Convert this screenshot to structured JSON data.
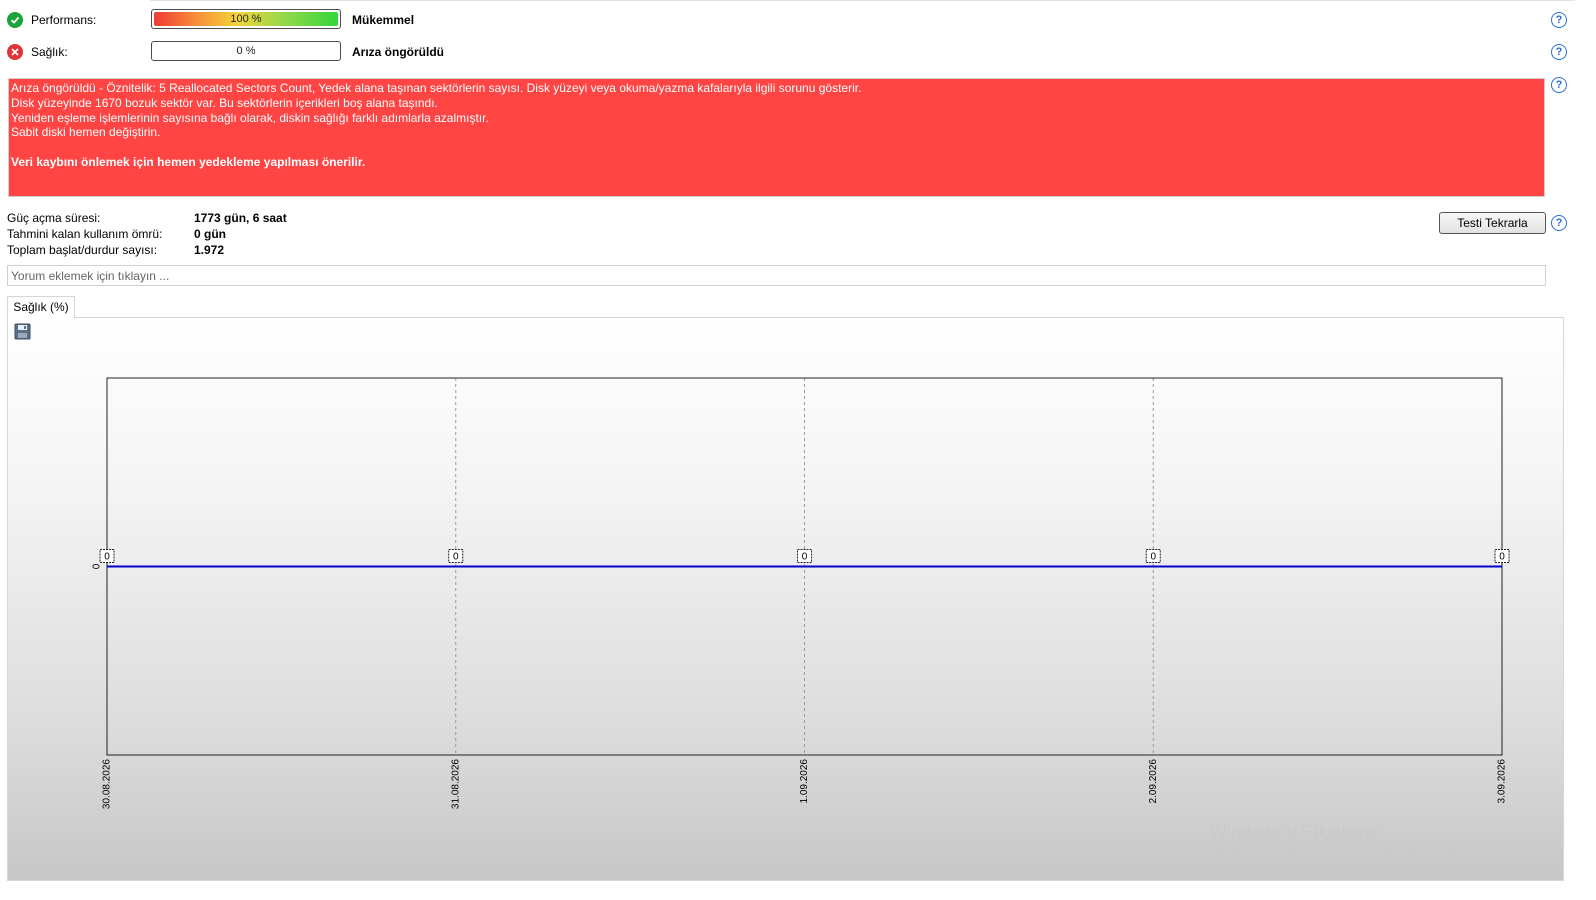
{
  "status": {
    "performance": {
      "label": "Performans:",
      "meter_text": "100 %",
      "level": 1.0,
      "verdict": "Mükemmel"
    },
    "health": {
      "label": "Sağlık:",
      "meter_text": "0 %",
      "level": 0.0,
      "verdict": "Arıza öngörüldü"
    }
  },
  "alert": {
    "lines": [
      "Arıza öngörüldü - Öznitelik: 5 Reallocated Sectors Count, Yedek alana taşınan sektörlerin sayısı. Disk yüzeyi veya okuma/yazma kafalarıyla ilgili sorunu gösterir.",
      "Disk yüzeyinde 1670 bozuk sektör var. Bu sektörlerin içerikleri boş alana taşındı.",
      "Yeniden eşleme işlemlerinin sayısına bağlı olarak, diskin sağlığı farklı adımlarla azalmıştır.",
      "Sabit diski hemen değiştirin."
    ],
    "recommendation": "Veri kaybını önlemek için hemen yedekleme yapılması önerilir.",
    "color": "#ff4444"
  },
  "info": {
    "power_on_label": "Güç açma süresi:",
    "power_on_value": "1773 gün, 6 saat",
    "remaining_label": "Tahmini kalan kullanım ömrü:",
    "remaining_value": "0 gün",
    "startstop_label": "Toplam başlat/durdur sayısı:",
    "startstop_value": "1.972"
  },
  "retest_label": "Testi Tekrarla",
  "comment": {
    "placeholder": "Yorum eklemek için tıklayın ...",
    "value": ""
  },
  "tab_label": "Sağlık (%)",
  "chart_data": {
    "type": "line",
    "x": [
      "30.08.2026",
      "31.08.2026",
      "1.09.2026",
      "2.09.2026",
      "3.09.2026"
    ],
    "series": [
      {
        "values": [
          0,
          0,
          0,
          0,
          0
        ],
        "color": "#0000cc"
      }
    ],
    "data_labels": [
      "0",
      "0",
      "0",
      "0",
      "0"
    ],
    "y_ticks": [
      "0"
    ],
    "grid": true
  },
  "watermark": {
    "title": "Windows'u Etkinleştir",
    "subtitle": "Windows'u etkinleştirmek için Ayarlar'a gidin."
  }
}
